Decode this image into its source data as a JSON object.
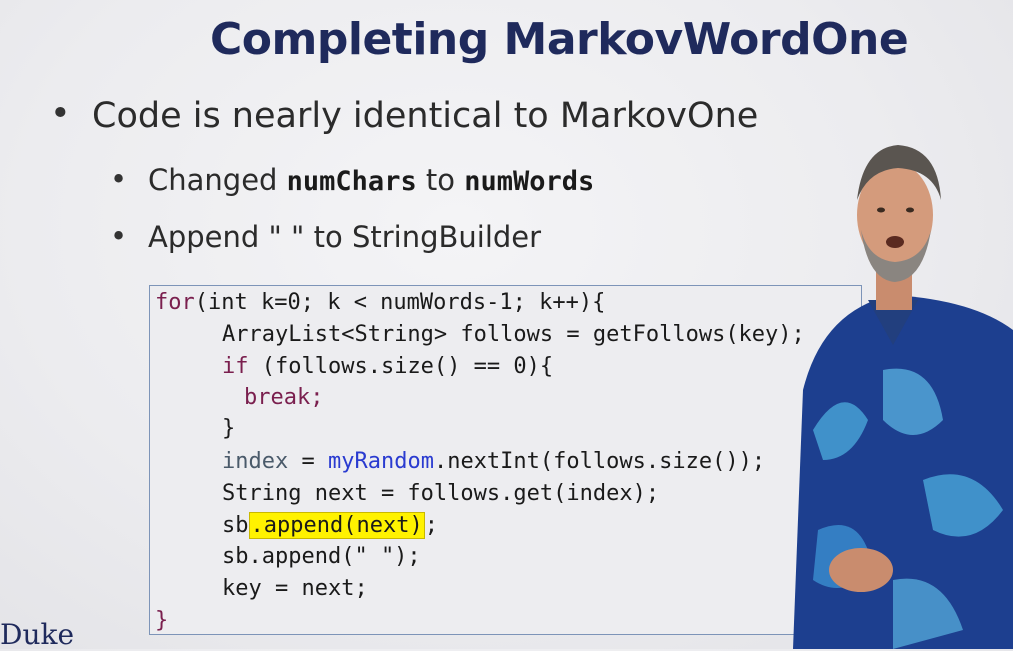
{
  "slide": {
    "title": "Completing MarkovWordOne",
    "bullet1": "Code is nearly identical to MarkovOne",
    "bullet2": {
      "prefix": "Changed ",
      "old": "numChars",
      "middle": " to ",
      "new": "numWords"
    },
    "bullet3": "Append \" \" to StringBuilder",
    "bullet_glyph": "•"
  },
  "code": {
    "l1": {
      "kw": "for",
      "rest": "(int k=0; k < numWords-1; k++){"
    },
    "l2": "ArrayList<String> follows = getFollows(key);",
    "l3": {
      "kw": "if",
      "rest": " (follows.size() == 0){"
    },
    "l4": "break;",
    "l5": "}",
    "l6": {
      "var": "index",
      "eq": " = ",
      "fld": "myRandom",
      "rest": ".nextInt(follows.size());"
    },
    "l7": "String next = follows.get(index);",
    "l8": {
      "pre": "sb",
      "hl": ".append(next)",
      "post": ";"
    },
    "l9": "sb.append(\" \");",
    "l10": "key = next;",
    "l11": "}"
  },
  "branding": {
    "logo_text": "Duke"
  },
  "colors": {
    "title": "#1f2a5c",
    "highlight": "#fff200",
    "keyword": "#7a1f4e",
    "field": "#2a3bd0"
  }
}
